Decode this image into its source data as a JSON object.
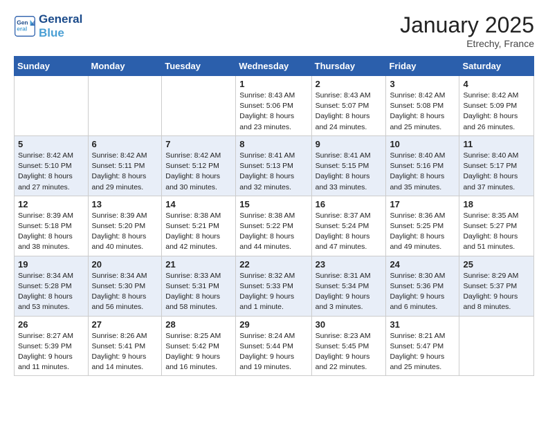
{
  "header": {
    "logo_line1": "General",
    "logo_line2": "Blue",
    "month": "January 2025",
    "location": "Etrechy, France"
  },
  "days_of_week": [
    "Sunday",
    "Monday",
    "Tuesday",
    "Wednesday",
    "Thursday",
    "Friday",
    "Saturday"
  ],
  "weeks": [
    [
      {
        "day": "",
        "info": ""
      },
      {
        "day": "",
        "info": ""
      },
      {
        "day": "",
        "info": ""
      },
      {
        "day": "1",
        "info": "Sunrise: 8:43 AM\nSunset: 5:06 PM\nDaylight: 8 hours and 23 minutes."
      },
      {
        "day": "2",
        "info": "Sunrise: 8:43 AM\nSunset: 5:07 PM\nDaylight: 8 hours and 24 minutes."
      },
      {
        "day": "3",
        "info": "Sunrise: 8:42 AM\nSunset: 5:08 PM\nDaylight: 8 hours and 25 minutes."
      },
      {
        "day": "4",
        "info": "Sunrise: 8:42 AM\nSunset: 5:09 PM\nDaylight: 8 hours and 26 minutes."
      }
    ],
    [
      {
        "day": "5",
        "info": "Sunrise: 8:42 AM\nSunset: 5:10 PM\nDaylight: 8 hours and 27 minutes."
      },
      {
        "day": "6",
        "info": "Sunrise: 8:42 AM\nSunset: 5:11 PM\nDaylight: 8 hours and 29 minutes."
      },
      {
        "day": "7",
        "info": "Sunrise: 8:42 AM\nSunset: 5:12 PM\nDaylight: 8 hours and 30 minutes."
      },
      {
        "day": "8",
        "info": "Sunrise: 8:41 AM\nSunset: 5:13 PM\nDaylight: 8 hours and 32 minutes."
      },
      {
        "day": "9",
        "info": "Sunrise: 8:41 AM\nSunset: 5:15 PM\nDaylight: 8 hours and 33 minutes."
      },
      {
        "day": "10",
        "info": "Sunrise: 8:40 AM\nSunset: 5:16 PM\nDaylight: 8 hours and 35 minutes."
      },
      {
        "day": "11",
        "info": "Sunrise: 8:40 AM\nSunset: 5:17 PM\nDaylight: 8 hours and 37 minutes."
      }
    ],
    [
      {
        "day": "12",
        "info": "Sunrise: 8:39 AM\nSunset: 5:18 PM\nDaylight: 8 hours and 38 minutes."
      },
      {
        "day": "13",
        "info": "Sunrise: 8:39 AM\nSunset: 5:20 PM\nDaylight: 8 hours and 40 minutes."
      },
      {
        "day": "14",
        "info": "Sunrise: 8:38 AM\nSunset: 5:21 PM\nDaylight: 8 hours and 42 minutes."
      },
      {
        "day": "15",
        "info": "Sunrise: 8:38 AM\nSunset: 5:22 PM\nDaylight: 8 hours and 44 minutes."
      },
      {
        "day": "16",
        "info": "Sunrise: 8:37 AM\nSunset: 5:24 PM\nDaylight: 8 hours and 47 minutes."
      },
      {
        "day": "17",
        "info": "Sunrise: 8:36 AM\nSunset: 5:25 PM\nDaylight: 8 hours and 49 minutes."
      },
      {
        "day": "18",
        "info": "Sunrise: 8:35 AM\nSunset: 5:27 PM\nDaylight: 8 hours and 51 minutes."
      }
    ],
    [
      {
        "day": "19",
        "info": "Sunrise: 8:34 AM\nSunset: 5:28 PM\nDaylight: 8 hours and 53 minutes."
      },
      {
        "day": "20",
        "info": "Sunrise: 8:34 AM\nSunset: 5:30 PM\nDaylight: 8 hours and 56 minutes."
      },
      {
        "day": "21",
        "info": "Sunrise: 8:33 AM\nSunset: 5:31 PM\nDaylight: 8 hours and 58 minutes."
      },
      {
        "day": "22",
        "info": "Sunrise: 8:32 AM\nSunset: 5:33 PM\nDaylight: 9 hours and 1 minute."
      },
      {
        "day": "23",
        "info": "Sunrise: 8:31 AM\nSunset: 5:34 PM\nDaylight: 9 hours and 3 minutes."
      },
      {
        "day": "24",
        "info": "Sunrise: 8:30 AM\nSunset: 5:36 PM\nDaylight: 9 hours and 6 minutes."
      },
      {
        "day": "25",
        "info": "Sunrise: 8:29 AM\nSunset: 5:37 PM\nDaylight: 9 hours and 8 minutes."
      }
    ],
    [
      {
        "day": "26",
        "info": "Sunrise: 8:27 AM\nSunset: 5:39 PM\nDaylight: 9 hours and 11 minutes."
      },
      {
        "day": "27",
        "info": "Sunrise: 8:26 AM\nSunset: 5:41 PM\nDaylight: 9 hours and 14 minutes."
      },
      {
        "day": "28",
        "info": "Sunrise: 8:25 AM\nSunset: 5:42 PM\nDaylight: 9 hours and 16 minutes."
      },
      {
        "day": "29",
        "info": "Sunrise: 8:24 AM\nSunset: 5:44 PM\nDaylight: 9 hours and 19 minutes."
      },
      {
        "day": "30",
        "info": "Sunrise: 8:23 AM\nSunset: 5:45 PM\nDaylight: 9 hours and 22 minutes."
      },
      {
        "day": "31",
        "info": "Sunrise: 8:21 AM\nSunset: 5:47 PM\nDaylight: 9 hours and 25 minutes."
      },
      {
        "day": "",
        "info": ""
      }
    ]
  ]
}
